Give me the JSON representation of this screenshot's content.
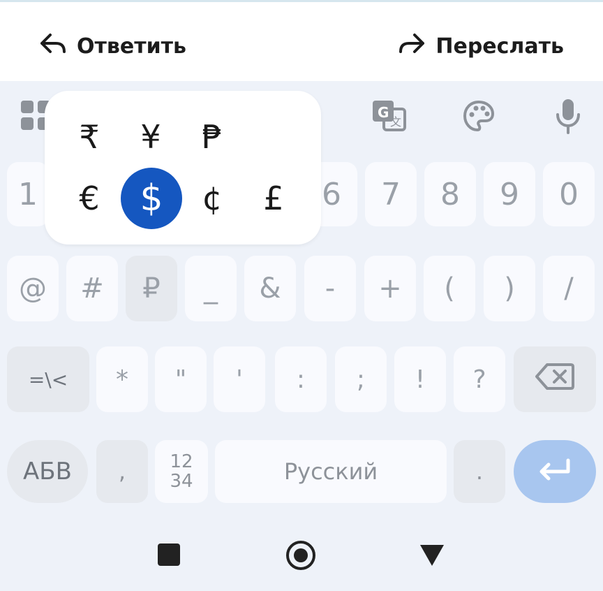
{
  "header": {
    "reply_label": "Ответить",
    "forward_label": "Переслать"
  },
  "currency_popup": {
    "row1": [
      "₹",
      "¥",
      "₱"
    ],
    "row2": [
      "€",
      "$",
      "¢",
      "£"
    ],
    "selected": "$"
  },
  "keyboard": {
    "digits": [
      "1",
      "6",
      "7",
      "8",
      "9",
      "0"
    ],
    "symbols_row": [
      "@",
      "#",
      "₽",
      "_",
      "&",
      "-",
      "+",
      "(",
      ")",
      "/"
    ],
    "punct_row": [
      "=\\<",
      "*",
      "\"",
      "'",
      ":",
      ";",
      "!",
      "?"
    ],
    "bottom": {
      "alphabet_label": "АБВ",
      "comma": ",",
      "numpad_top": "12",
      "numpad_bottom": "34",
      "space_label": "Русский",
      "period": "."
    }
  },
  "colors": {
    "accent": "#1557c0",
    "enter_key": "#a8c6ef",
    "keyboard_bg": "#eef2f9"
  },
  "icons": {
    "toolbar": [
      "apps-icon",
      "translate-icon",
      "palette-icon",
      "microphone-icon"
    ],
    "nav": [
      "recents-square-icon",
      "home-circle-icon",
      "back-triangle-icon"
    ]
  }
}
